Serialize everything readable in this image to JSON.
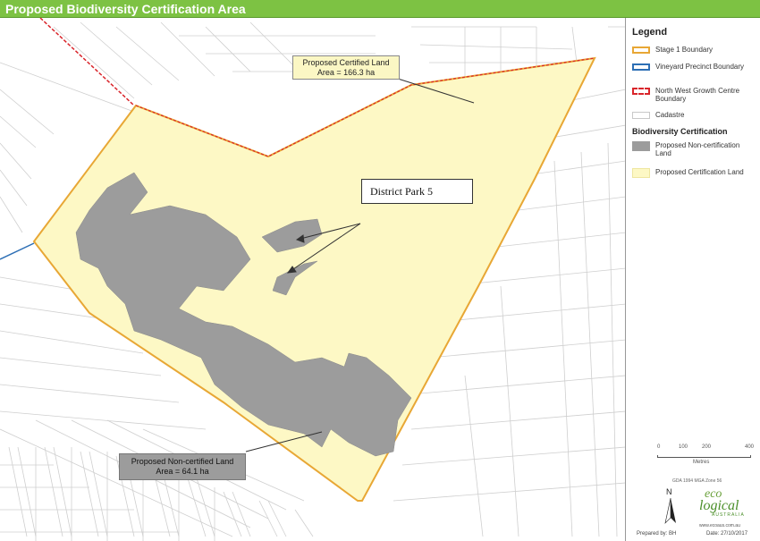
{
  "title": "Proposed Biodiversity Certification Area",
  "map": {
    "certified_label": [
      "Proposed Certified Land",
      "Area = 166.3 ha"
    ],
    "noncertified_label": [
      "Proposed Non-certified Land",
      "Area = 64.1 ha"
    ],
    "park_label": "District Park 5"
  },
  "legend": {
    "title": "Legend",
    "items": [
      {
        "label": "Stage 1 Boundary",
        "color": "#e8a735"
      },
      {
        "label": "Vineyard Precinct Boundary",
        "color": "#2d6fb5"
      },
      {
        "label": "North West Growth Centre Boundary",
        "color": "#d9252b"
      },
      {
        "label": "Cadastre",
        "color": "#c8c8c8"
      }
    ],
    "section_title": "Biodiversity Certification",
    "section_items": [
      {
        "label": "Proposed Non-certification Land",
        "color": "#9c9c9c"
      },
      {
        "label": "Proposed Certification Land",
        "color": "#fdf8c5"
      }
    ]
  },
  "scale": {
    "ticks": [
      "0",
      "100",
      "200",
      "400"
    ],
    "unit": "Metres",
    "datum": "GDA 1994 MGA Zone 56"
  },
  "north_label": "N",
  "logo": {
    "line1": "eco",
    "line2": "logical",
    "line3": "AUSTRALIA"
  },
  "website": "www.ecoaus.com.au",
  "prepared_by": "Prepared by: BH",
  "date": "Date: 27/10/2017"
}
